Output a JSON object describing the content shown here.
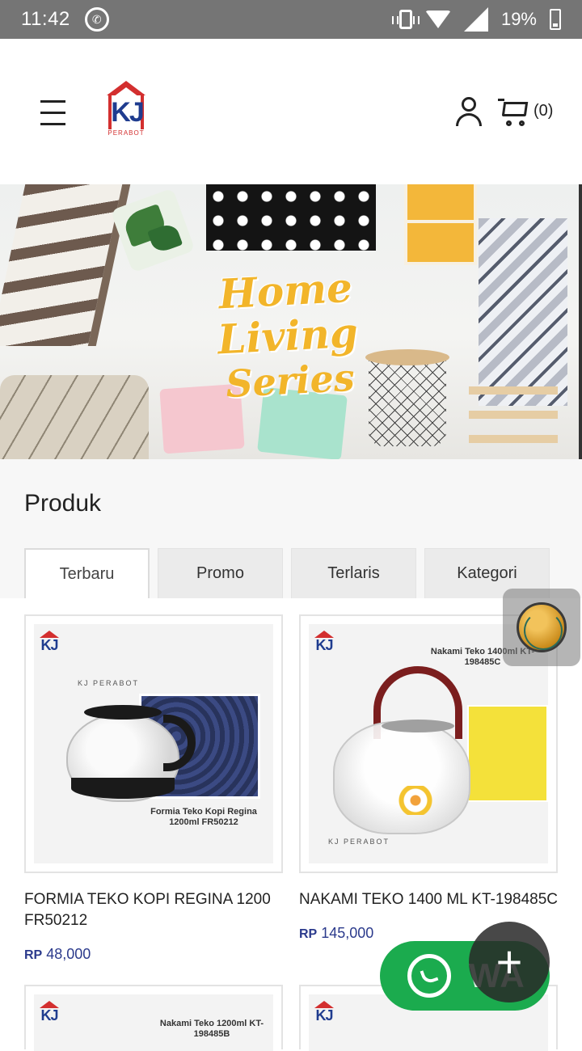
{
  "status_bar": {
    "time": "11:42",
    "battery": "19%",
    "icons": [
      "whatsapp-icon",
      "vibrate-icon",
      "wifi-icon",
      "signal-icon",
      "battery-icon"
    ]
  },
  "header": {
    "logo_text": "KJ",
    "logo_sub": "PERABOT",
    "cart_count": "(0)",
    "icons": [
      "menu-icon",
      "user-icon",
      "cart-icon"
    ]
  },
  "banner": {
    "title_line1": "Home Living",
    "title_line2": "Series"
  },
  "section": {
    "title": "Produk",
    "tabs": [
      {
        "label": "Terbaru",
        "active": true
      },
      {
        "label": "Promo",
        "active": false
      },
      {
        "label": "Terlaris",
        "active": false
      },
      {
        "label": "Kategori",
        "active": false
      }
    ]
  },
  "products": [
    {
      "name": "FORMIA TEKO KOPI REGINA 1200 FR50212",
      "currency": "RP",
      "price": "48,000",
      "image_brand": "KJ PERABOT",
      "image_caption": "Formia Teko Kopi Regina 1200ml FR50212"
    },
    {
      "name": "NAKAMI TEKO 1400 ML KT-198485C",
      "currency": "RP",
      "price": "145,000",
      "image_brand": "KJ PERABOT",
      "image_caption": "Nakami Teko 1400ml KT-198485C"
    },
    {
      "image_caption": "Nakami Teko 1200ml KT-198485B"
    },
    {
      "image_caption": ""
    }
  ],
  "floating": {
    "wa_label": "WA",
    "plus_label": "+"
  },
  "colors": {
    "status_bar": "#757575",
    "brand_red": "#d32f2f",
    "brand_blue": "#1f3c8f",
    "price_blue": "#2b3a8c",
    "whatsapp_green": "#1bab4e",
    "banner_title": "#f2b52a"
  }
}
